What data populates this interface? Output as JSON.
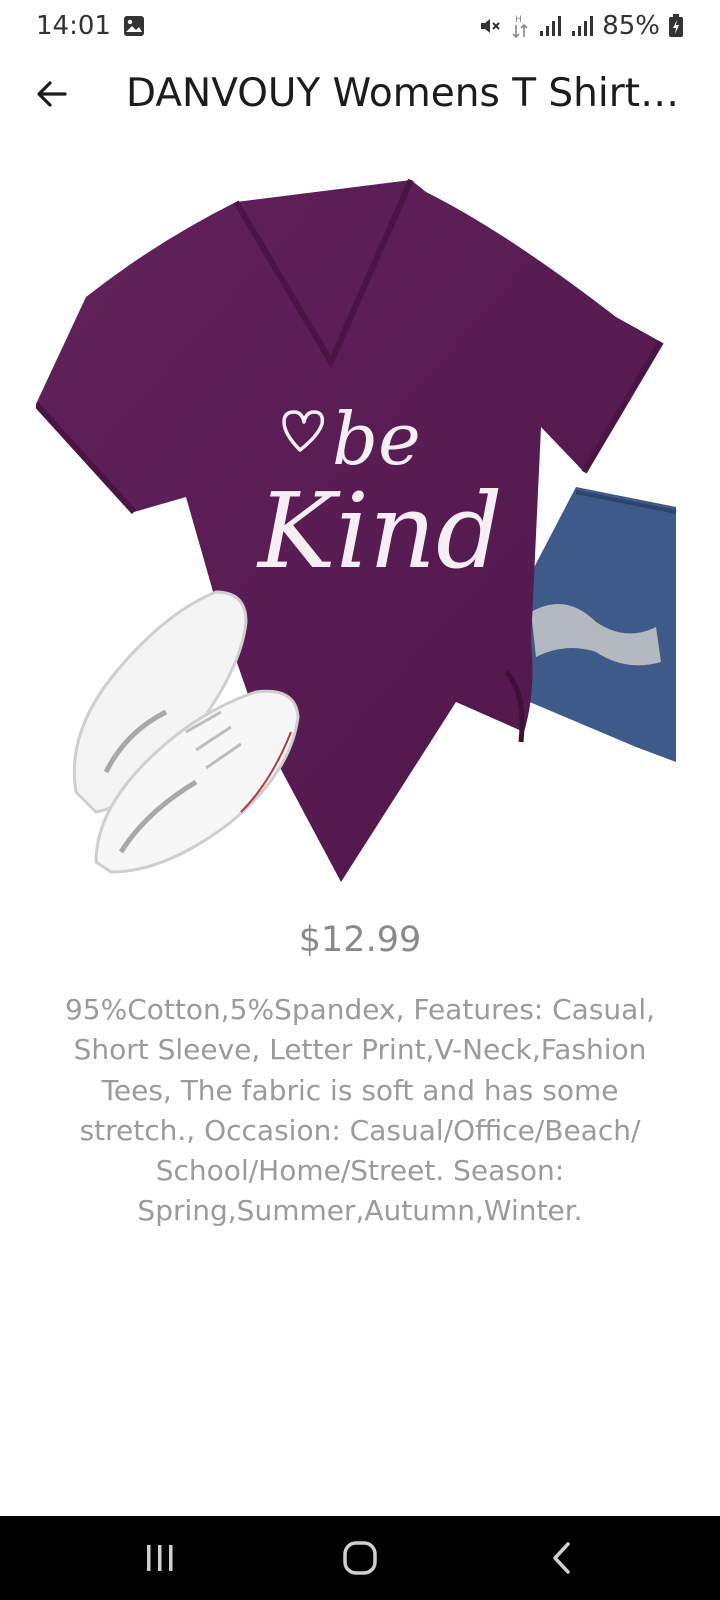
{
  "status_bar": {
    "time": "14:01",
    "battery": "85%",
    "icons": [
      "image-notification-icon",
      "mute-icon",
      "data-transfer-icon",
      "signal-icon",
      "signal-icon",
      "battery-charging-icon"
    ]
  },
  "app_bar": {
    "back_icon": "arrow-left-icon",
    "title": "DANVOUY Womens T Shirt C…"
  },
  "product": {
    "image_print_text": "be Kind",
    "price": "$12.99",
    "description": "95%Cotton,5%Spandex, Features: Casual, Short Sleeve, Letter Print,V-Neck,Fashion Tees, The fabric is soft and has some stretch., Occasion: Casual/Office/Beach/ School/Home/Street. Season: Spring,Summer,Autumn,Winter."
  },
  "nav_bar": {
    "icons": [
      "recents-icon",
      "home-icon",
      "back-icon"
    ]
  },
  "colors": {
    "shirt": "#5b1d55",
    "price_text": "#8a8a8a",
    "description_text": "#9b9b9b",
    "nav_background": "#000000"
  }
}
